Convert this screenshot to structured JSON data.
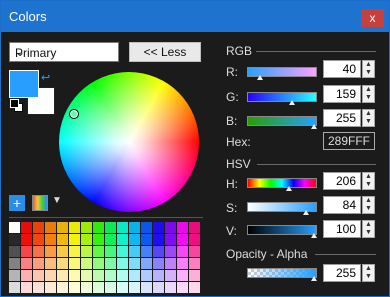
{
  "window": {
    "title": "Colors",
    "close_glyph": "x"
  },
  "picker": {
    "mode_value": "Primary",
    "less_button": "<< Less",
    "primary_color": "#289FFF",
    "secondary_color": "#FFFFFF"
  },
  "rgb": {
    "section_label": "RGB",
    "r": {
      "label": "R:",
      "value": "40"
    },
    "g": {
      "label": "G:",
      "value": "159"
    },
    "b": {
      "label": "B:",
      "value": "255"
    },
    "hex_label": "Hex:",
    "hex_value": "289FFF"
  },
  "hsv": {
    "section_label": "HSV",
    "h": {
      "label": "H:",
      "value": "206"
    },
    "s": {
      "label": "S:",
      "value": "84"
    },
    "v": {
      "label": "V:",
      "value": "100"
    }
  },
  "alpha": {
    "section_label": "Opacity - Alpha",
    "value": "255"
  },
  "icons": [
    "swap-colors-icon",
    "reset-colors-icon",
    "add-palette-color-icon",
    "palette-icon",
    "chevron-down-icon"
  ]
}
